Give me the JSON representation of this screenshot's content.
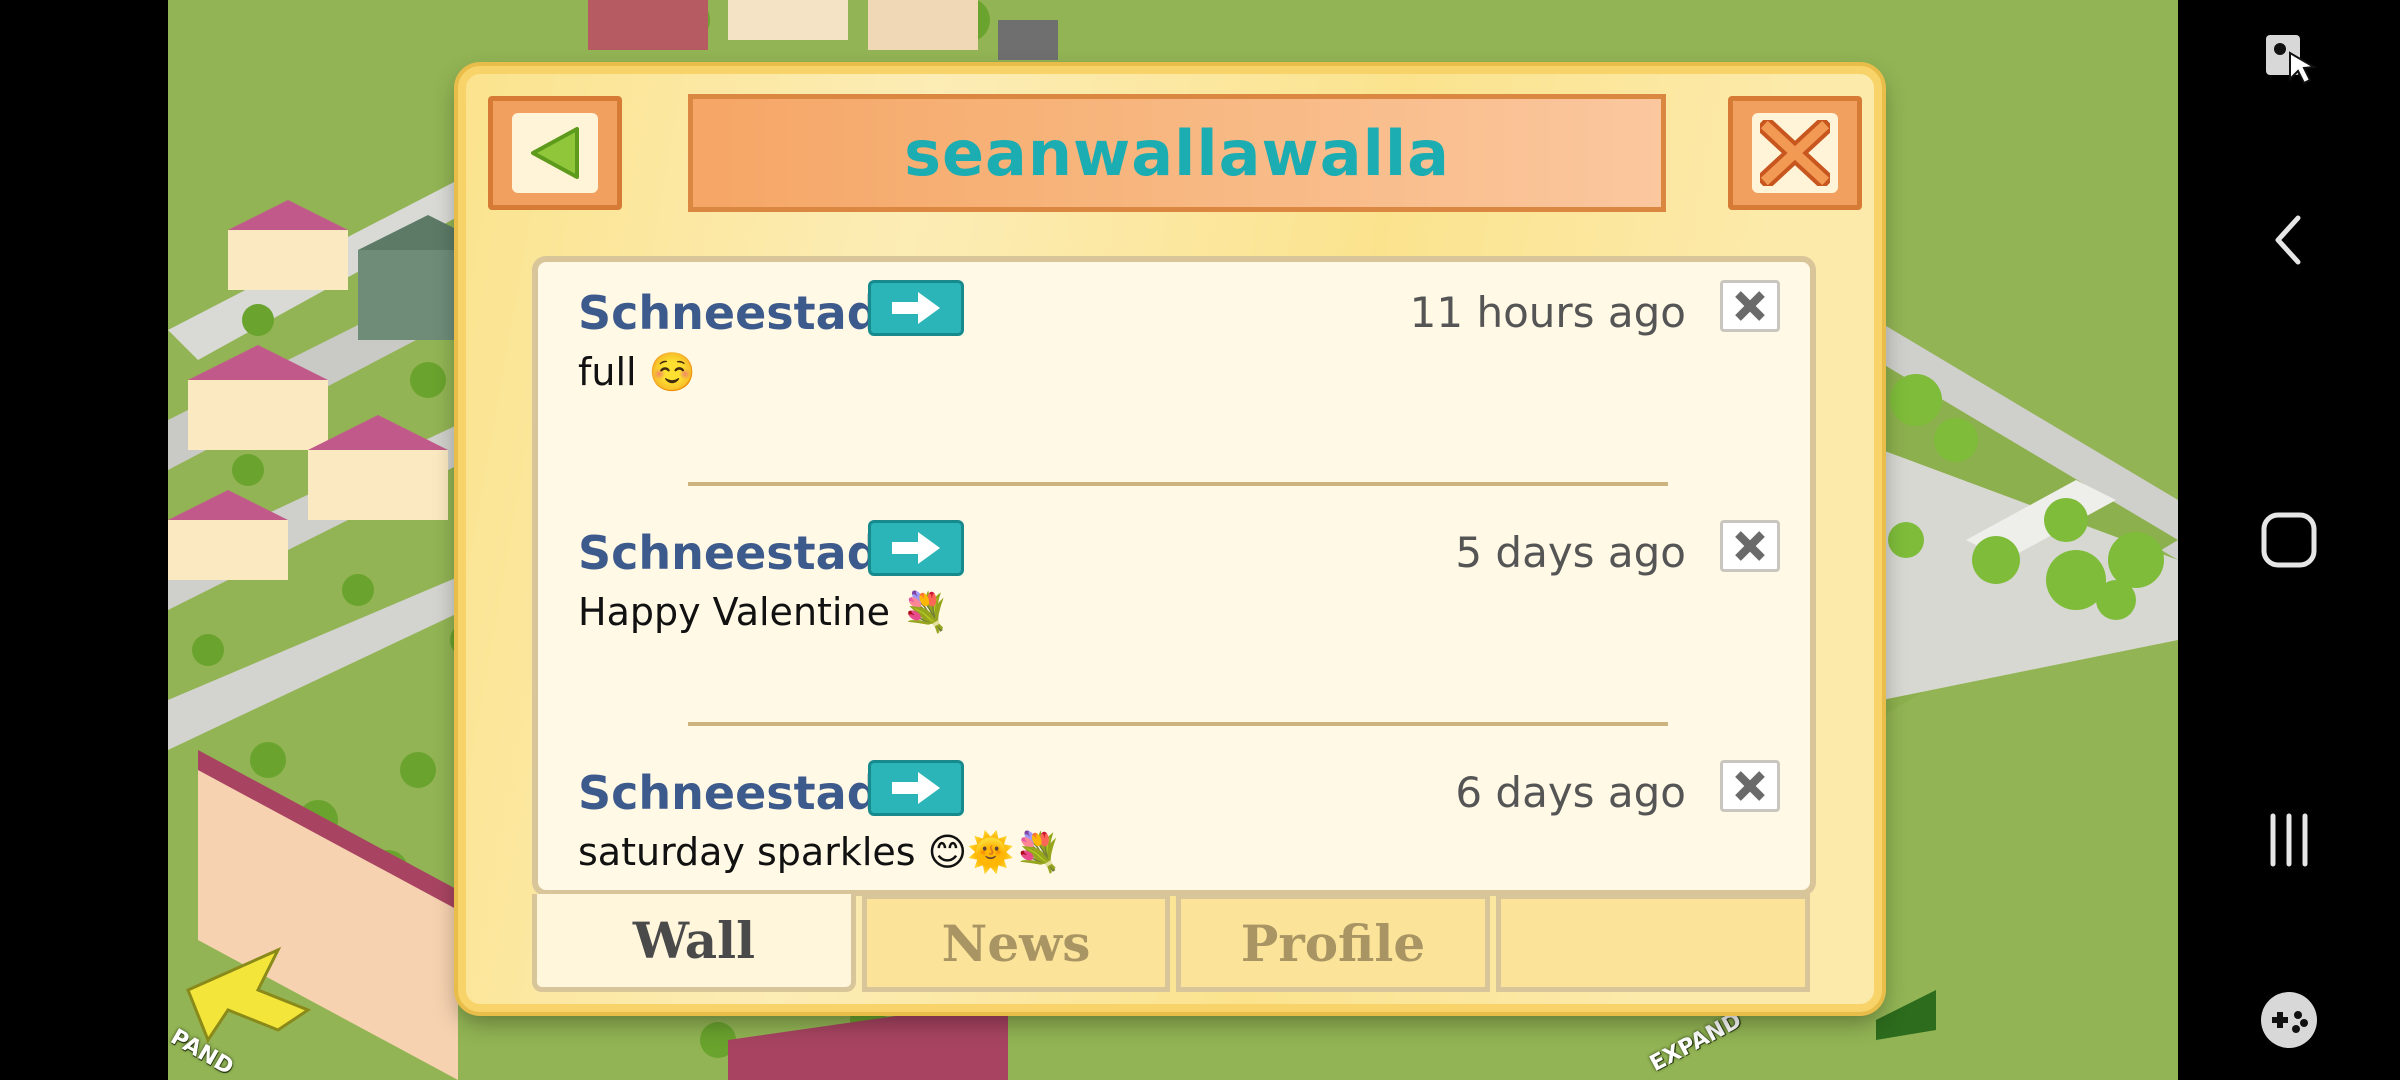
{
  "dialog": {
    "title": "seanwallawalla",
    "posts": [
      {
        "author": "Schneestadt",
        "time": "11 hours ago",
        "body": "full ☺️"
      },
      {
        "author": "Schneestadt",
        "time": "5 days ago",
        "body": "Happy Valentine 💐"
      },
      {
        "author": "Schneestadt",
        "time": "6 days ago",
        "body": "saturday sparkles 😊🌞💐"
      }
    ],
    "tabs": [
      "Wall",
      "News",
      "Profile",
      ""
    ],
    "active_tab": "Wall"
  },
  "game": {
    "expand_left": "PAND",
    "expand_right": "EXPAND"
  },
  "icons": {
    "back": "green-triangle-left-icon",
    "close": "orange-x-icon",
    "visit": "cyan-arrow-right-icon",
    "delete": "gray-x-icon",
    "nav": [
      "screen-assist-icon",
      "back-chevron-icon",
      "home-square-icon",
      "recents-icon",
      "game-launcher-icon"
    ]
  },
  "colors": {
    "title": "#1cadb3",
    "author": "#3d5a8c",
    "panel": "#fbe38e",
    "accent_orange": "#f1a060"
  }
}
